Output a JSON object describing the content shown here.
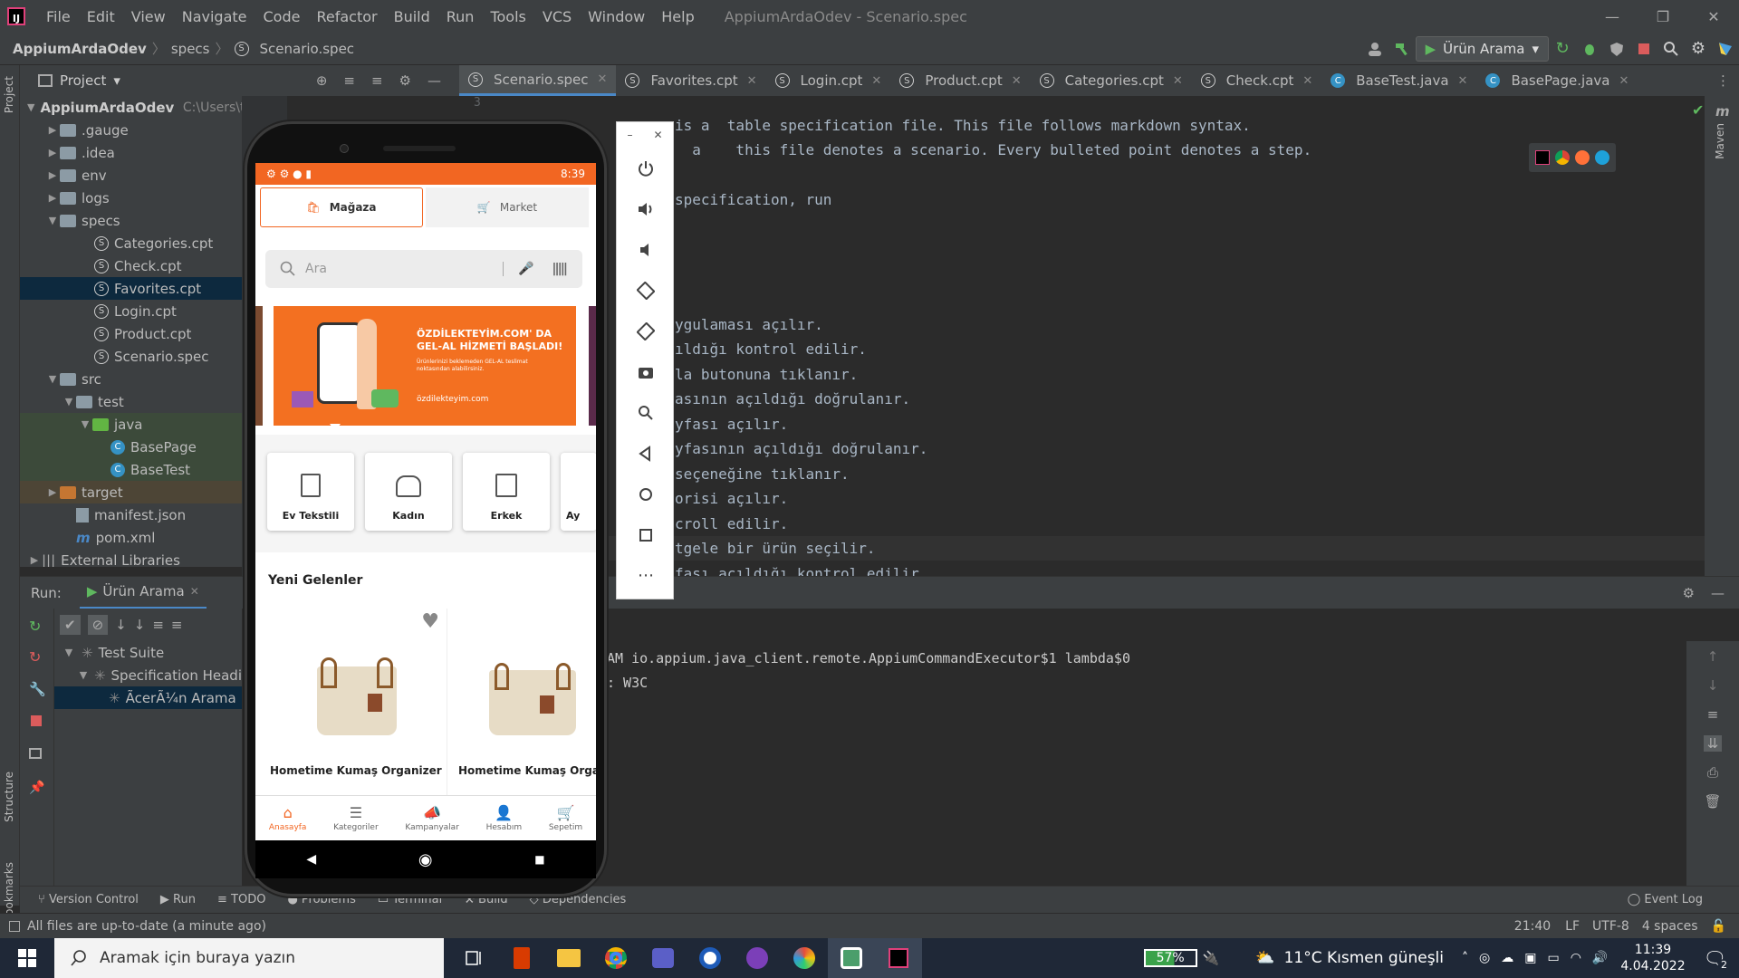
{
  "menu": [
    "File",
    "Edit",
    "View",
    "Navigate",
    "Code",
    "Refactor",
    "Build",
    "Run",
    "Tools",
    "VCS",
    "Window",
    "Help"
  ],
  "window_title": "AppiumArdaOdev - Scenario.spec",
  "breadcrumb": {
    "project": "AppiumArdaOdev",
    "folder": "specs",
    "file": "Scenario.spec"
  },
  "run_config": "Ürün Arama",
  "project_panel": {
    "title": "Project"
  },
  "tree": {
    "root": "AppiumArdaOdev",
    "root_path": "C:\\Users\\testinium\\IdeaProjects\\AppiumArd",
    "gauge": ".gauge",
    "idea": ".idea",
    "env": "env",
    "logs": "logs",
    "specs": "specs",
    "categories": "Categories.cpt",
    "check": "Check.cpt",
    "favorites": "Favorites.cpt",
    "login": "Login.cpt",
    "product": "Product.cpt",
    "scenario": "Scenario.spec",
    "src": "src",
    "test": "test",
    "java": "java",
    "basepage": "BasePage",
    "basetest": "BaseTest",
    "target": "target",
    "manifest": "manifest.json",
    "pom": "pom.xml",
    "external": "External Libraries"
  },
  "tabs": [
    "Scenario.spec",
    "Favorites.cpt",
    "Login.cpt",
    "Product.cpt",
    "Categories.cpt",
    "Check.cpt",
    "BaseTest.java",
    "BasePage.java"
  ],
  "gutter_line": "3",
  "code": [
    "is a  table specification file. This file follows markdown syntax.",
    "  a    this file denotes a scenario. Every bulleted point denotes a step.",
    "specification, run",
    "ygulaması açılır.",
    "ıldığı kontrol edilir.",
    "la butonuna tıklanır.",
    "asının açıldığı doğrulanır.",
    "yfası açılır.",
    "yfasının açıldığı doğrulanır.",
    "seçeneğine tıklanır.",
    "orisi açılır.",
    "croll edilir.",
    "tgele bir ürün seçilir.",
    "fası açıldığı kontrol edilir."
  ],
  "run_panel": {
    "label": "Run:",
    "config": "Ürün Arama",
    "suite": "Test Suite",
    "spec": "Specification Headi",
    "scenario": "ÃcerÃ¼n Arama"
  },
  "console": [
    "AM io.appium.java_client.remote.AppiumCommandExecutor$1 lambda$0",
    ": W3C"
  ],
  "toolwindows": [
    "Version Control",
    "Run",
    "TODO",
    "Problems",
    "Terminal",
    "Build",
    "Dependencies"
  ],
  "event_log": "Event Log",
  "status": {
    "message": "All files are up-to-date (a minute ago)",
    "position": "21:40",
    "line_sep": "LF",
    "encoding": "UTF-8",
    "indent": "4 spaces"
  },
  "left_strip": {
    "project": "Project",
    "structure": "Structure",
    "bookmarks": "Bookmarks"
  },
  "right_strip": {
    "maven": "Maven"
  },
  "phone": {
    "time": "8:39",
    "tab_store": "Mağaza",
    "tab_market": "Market",
    "search_placeholder": "Ara",
    "banner_title": "ÖZDİLEKTEYİM.COM' DA GEL-AL HİZMETİ BAŞLADI!",
    "banner_sub": "Ürünlerinizi beklemeden GEL-AL teslimat noktasından alabilirsiniz.",
    "banner_brand": "özdilekteyim.com",
    "categories": [
      "Ev Tekstili",
      "Kadın",
      "Erkek",
      "Ay"
    ],
    "new_title": "Yeni Gelenler",
    "products": [
      "Hometime Kumaş Organizer",
      "Hometime Kumaş Orgar"
    ],
    "bottom_nav": [
      "Anasayfa",
      "Kategoriler",
      "Kampanyalar",
      "Hesabım",
      "Sepetim"
    ]
  },
  "taskbar": {
    "search": "Aramak için buraya yazın",
    "battery": "57%",
    "weather": "11°C  Kısmen güneşli",
    "time": "11:39",
    "date": "4.04.2022",
    "notif": "2"
  },
  "colors": {
    "accent": "#f26622",
    "ide_bg": "#2b2b2b",
    "panel": "#3c3f41",
    "selection": "#0d293e"
  }
}
